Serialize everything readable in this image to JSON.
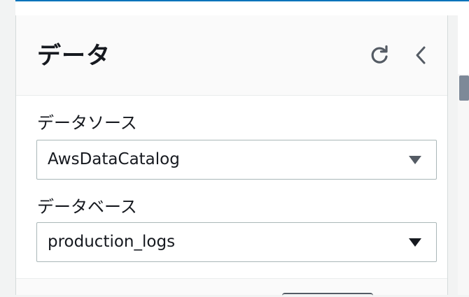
{
  "panel": {
    "title": "データ",
    "refresh_icon": "refresh-icon",
    "collapse_icon": "chevron-left-icon"
  },
  "data_source": {
    "label": "データソース",
    "value": "AwsDataCatalog"
  },
  "database": {
    "label": "データベース",
    "value": "production_logs"
  },
  "colors": {
    "accent_line": "#0073bb",
    "text": "#16191f",
    "border": "#aab7b8",
    "caret_disabled": "#545b64",
    "caret_active": "#16191f"
  }
}
